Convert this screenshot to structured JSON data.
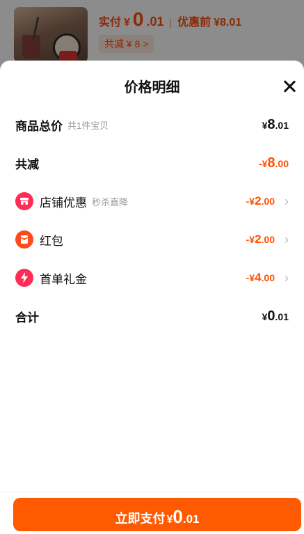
{
  "background": {
    "paid_label": "实付",
    "currency": "¥",
    "paid_int": "0",
    "paid_dec": ".01",
    "separator": "|",
    "before_label": "优惠前",
    "before_amount": "¥8.01",
    "discount_tag": "共减 ¥ 8 >"
  },
  "sheet": {
    "title": "价格明细",
    "rows": [
      {
        "label": "商品总价",
        "sub": "共1件宝贝",
        "sign": "",
        "currency": "¥",
        "int": "8",
        "dec": ".01"
      },
      {
        "label": "共减",
        "sign": "-",
        "currency": "¥",
        "int": "8",
        "dec": ".00"
      },
      {
        "label": "店铺优惠",
        "sub": "秒杀直降",
        "sign": "-",
        "currency": "¥",
        "int": "2",
        "dec": ".00",
        "icon": "store-icon"
      },
      {
        "label": "红包",
        "sign": "-",
        "currency": "¥",
        "int": "2",
        "dec": ".00",
        "icon": "red-envelope-icon"
      },
      {
        "label": "首单礼金",
        "sign": "-",
        "currency": "¥",
        "int": "4",
        "dec": ".00",
        "icon": "lightning-icon"
      },
      {
        "label": "合计",
        "sign": "",
        "currency": "¥",
        "int": "0",
        "dec": ".01"
      }
    ]
  },
  "footer": {
    "pay_label": "立即支付",
    "currency": "¥",
    "int": "0",
    "dec": ".01"
  },
  "colors": {
    "accent": "#ff5000",
    "button": "#ff5a00",
    "icon_red": "#ff2d55"
  }
}
